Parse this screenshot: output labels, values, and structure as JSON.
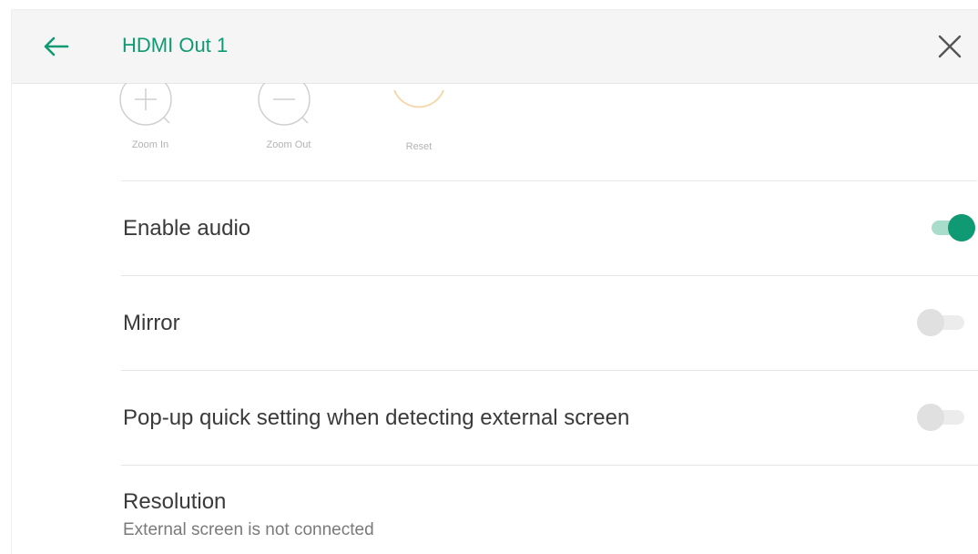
{
  "header": {
    "title": "HDMI Out 1",
    "back_icon": "arrow-left-icon",
    "close_icon": "close-icon",
    "accent_color": "#0f9a73"
  },
  "zoom_controls": [
    {
      "label": "Zoom In",
      "icon": "zoom-in-icon"
    },
    {
      "label": "Zoom Out",
      "icon": "zoom-out-icon"
    },
    {
      "label": "Reset",
      "icon": "reset-icon"
    }
  ],
  "settings": {
    "enable_audio": {
      "label": "Enable audio",
      "enabled": true
    },
    "mirror": {
      "label": "Mirror",
      "enabled": false
    },
    "popup_quick_setting": {
      "label": "Pop-up quick setting when detecting external screen",
      "enabled": false
    },
    "resolution": {
      "label": "Resolution",
      "subtitle": "External screen is not connected"
    }
  }
}
